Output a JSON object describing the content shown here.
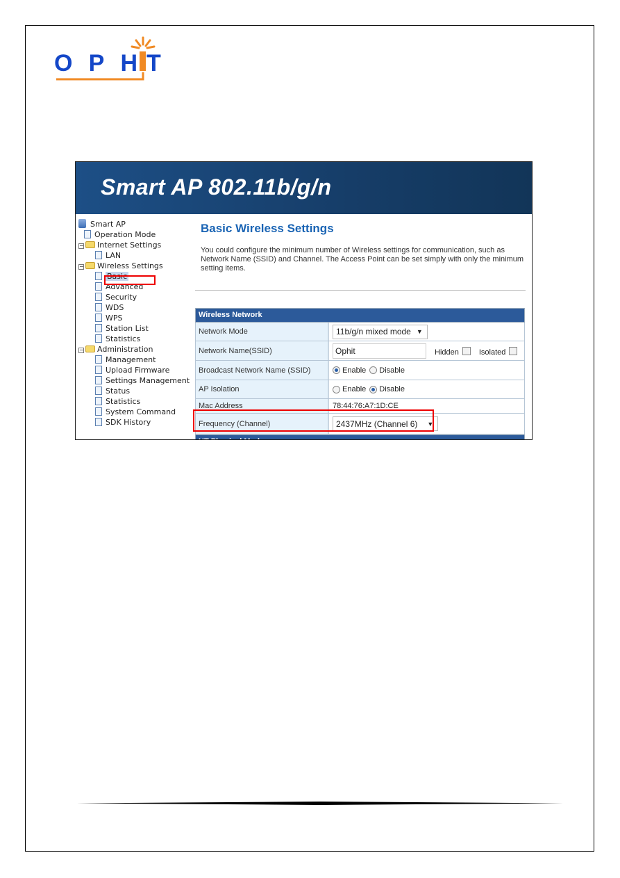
{
  "logo": {
    "text": "OPHIT",
    "colors": {
      "blue": "#1447c8",
      "orange": "#f08a24"
    }
  },
  "router_ui": {
    "header_title": "Smart AP 802.11b/g/n",
    "tree": [
      {
        "label": "Smart AP",
        "icon": "computer-icon",
        "level": 0
      },
      {
        "label": "Operation Mode",
        "icon": "page-icon",
        "level": 1
      },
      {
        "label": "Internet Settings",
        "icon": "folder-icon",
        "level": 1
      },
      {
        "label": "LAN",
        "icon": "page-icon",
        "level": 2
      },
      {
        "label": "Wireless Settings",
        "icon": "folder-icon",
        "level": 1
      },
      {
        "label": "Basic",
        "icon": "page-icon",
        "level": 2,
        "selected": true
      },
      {
        "label": "Advanced",
        "icon": "page-icon",
        "level": 2
      },
      {
        "label": "Security",
        "icon": "page-icon",
        "level": 2
      },
      {
        "label": "WDS",
        "icon": "page-icon",
        "level": 2
      },
      {
        "label": "WPS",
        "icon": "page-icon",
        "level": 2
      },
      {
        "label": "Station List",
        "icon": "page-icon",
        "level": 2
      },
      {
        "label": "Statistics",
        "icon": "page-icon",
        "level": 2
      },
      {
        "label": "Administration",
        "icon": "folder-icon",
        "level": 1
      },
      {
        "label": "Management",
        "icon": "page-icon",
        "level": 2
      },
      {
        "label": "Upload Firmware",
        "icon": "page-icon",
        "level": 2
      },
      {
        "label": "Settings Management",
        "icon": "page-icon",
        "level": 2
      },
      {
        "label": "Status",
        "icon": "page-icon",
        "level": 2
      },
      {
        "label": "Statistics",
        "icon": "page-icon",
        "level": 2
      },
      {
        "label": "System Command",
        "icon": "page-icon",
        "level": 2
      },
      {
        "label": "SDK History",
        "icon": "page-icon",
        "level": 2
      }
    ],
    "content": {
      "title": "Basic Wireless Settings",
      "description": "You could configure the minimum number of Wireless settings for communication, such as Network Name (SSID) and Channel. The Access Point can be set simply with only the minimum setting items.",
      "section_header": "Wireless Network",
      "network_mode": {
        "label": "Network Mode",
        "value": "11b/g/n mixed mode"
      },
      "ssid": {
        "label": "Network Name(SSID)",
        "value": "Ophit",
        "hidden_label": "Hidden",
        "isolated_label": "Isolated",
        "hidden": false,
        "isolated": false
      },
      "broadcast": {
        "label": "Broadcast Network Name (SSID)",
        "enable": "Enable",
        "disable": "Disable",
        "selected": "Enable"
      },
      "ap_isolation": {
        "label": "AP Isolation",
        "enable": "Enable",
        "disable": "Disable",
        "selected": "Disable"
      },
      "mac": {
        "label": "Mac Address",
        "value": "78:44:76:A7:1D:CE"
      },
      "frequency": {
        "label": "Frequency (Channel)",
        "value": "2437MHz (Channel 6)"
      },
      "next_section_header": "HT Physical Mode"
    },
    "highlight_color": "#e00000"
  }
}
